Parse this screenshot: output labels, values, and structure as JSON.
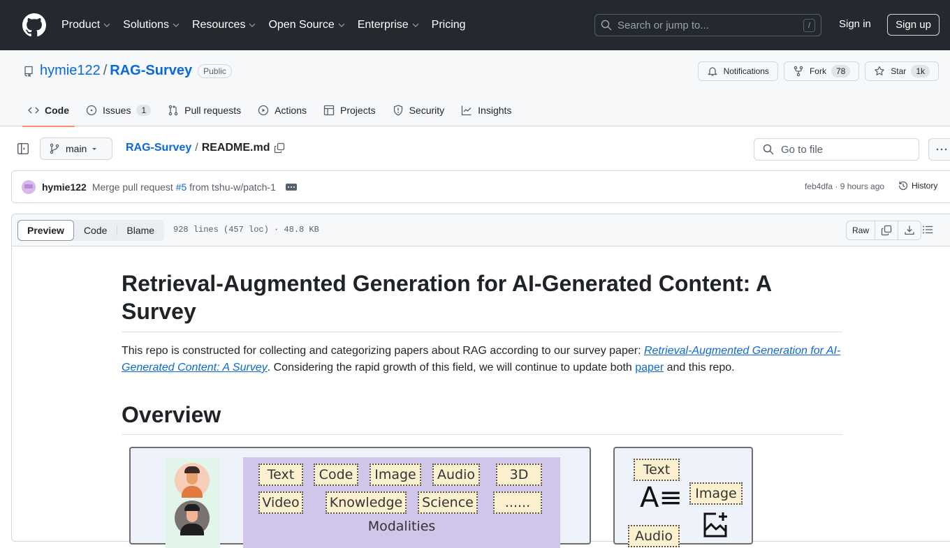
{
  "header": {
    "nav": [
      {
        "label": "Product",
        "dropdown": true
      },
      {
        "label": "Solutions",
        "dropdown": true
      },
      {
        "label": "Resources",
        "dropdown": true
      },
      {
        "label": "Open Source",
        "dropdown": true
      },
      {
        "label": "Enterprise",
        "dropdown": true
      },
      {
        "label": "Pricing",
        "dropdown": false
      }
    ],
    "search_placeholder": "Search or jump to...",
    "search_shortcut": "/",
    "sign_in": "Sign in",
    "sign_up": "Sign up"
  },
  "repo": {
    "owner": "hymie122",
    "separator": "/",
    "name": "RAG-Survey",
    "visibility": "Public",
    "notifications_label": "Notifications",
    "fork_label": "Fork",
    "fork_count": "78",
    "star_label": "Star",
    "star_count": "1k",
    "tabs": [
      {
        "label": "Code",
        "active": true
      },
      {
        "label": "Issues",
        "count": "1"
      },
      {
        "label": "Pull requests"
      },
      {
        "label": "Actions"
      },
      {
        "label": "Projects"
      },
      {
        "label": "Security"
      },
      {
        "label": "Insights"
      }
    ]
  },
  "file_nav": {
    "branch": "main",
    "crumb_repo": "RAG-Survey",
    "crumb_sep": "/",
    "crumb_file": "README.md",
    "goto_placeholder": "Go to file"
  },
  "commit": {
    "author": "hymie122",
    "message_prefix": "Merge pull request ",
    "pr_link": "#5",
    "message_suffix": " from tshu-w/patch-1",
    "sha_time": "feb4dfa · 9 hours ago",
    "history_label": "History"
  },
  "file": {
    "view_tabs": [
      "Preview",
      "Code",
      "Blame"
    ],
    "active_view": "Preview",
    "info": "928 lines (457 loc) · 48.8 KB",
    "raw_label": "Raw"
  },
  "readme": {
    "title": "Retrieval-Augmented Generation for AI-Generated Content: A Survey",
    "intro_before": "This repo is constructed for collecting and categorizing papers about RAG according to our survey paper: ",
    "intro_link": "Retrieval-Augmented Generation for AI-Generated Content: A Survey",
    "intro_middle": ". Considering the rapid growth of this field, we will continue to update both ",
    "intro_link2": "paper",
    "intro_after": " and this repo.",
    "overview_heading": "Overview",
    "figure": {
      "modalities_row1": [
        "Text",
        "Code",
        "Image",
        "Audio",
        "3D"
      ],
      "modalities_row2": [
        "Video",
        "Knowledge",
        "Science",
        "......"
      ],
      "modalities_label": "Modalities",
      "side_chips": [
        "Text",
        "Image",
        "Audio"
      ]
    }
  },
  "colors": {
    "header_bg": "#24292f",
    "link": "#0969da",
    "active_tab_underline": "#fd8c73"
  }
}
